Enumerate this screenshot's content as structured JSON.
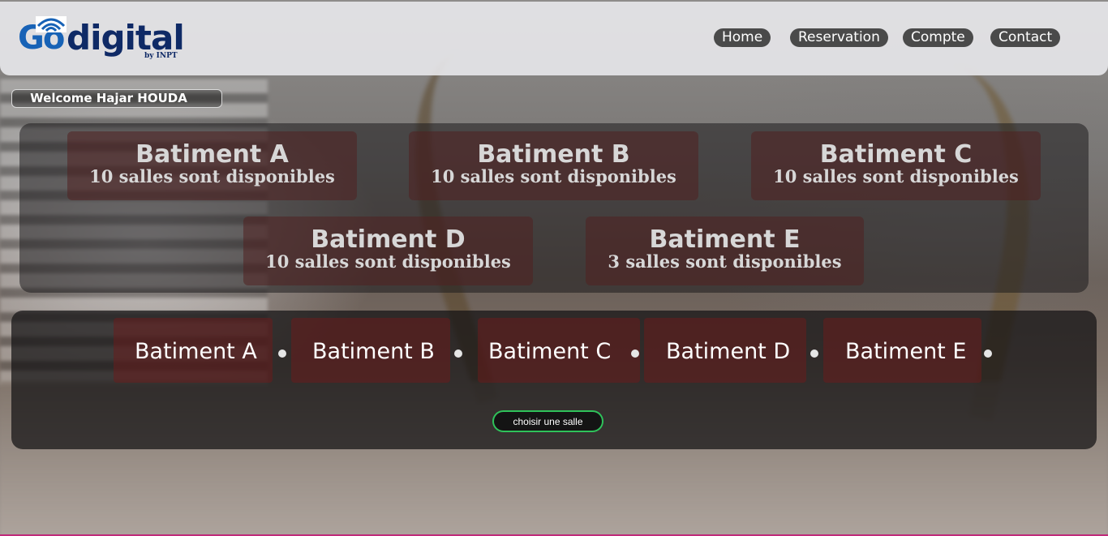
{
  "brand": {
    "logo_go": "Go",
    "logo_digital": "digital",
    "logo_by": "by INPT"
  },
  "nav": [
    {
      "label": "Home"
    },
    {
      "label": "Reservation"
    },
    {
      "label": "Compte"
    },
    {
      "label": "Contact"
    }
  ],
  "welcome": "Welcome Hajar HOUDA",
  "buildings": [
    {
      "name": "Batiment A",
      "availability": "10 salles sont disponibles"
    },
    {
      "name": "Batiment B",
      "availability": "10 salles sont disponibles"
    },
    {
      "name": "Batiment C",
      "availability": "10 salles sont disponibles"
    },
    {
      "name": "Batiment D",
      "availability": "10 salles sont disponibles"
    },
    {
      "name": "Batiment E",
      "availability": "3 salles sont disponibles"
    }
  ],
  "tabs": [
    {
      "label": "Batiment A"
    },
    {
      "label": "Batiment B"
    },
    {
      "label": "Batiment C"
    },
    {
      "label": "Batiment D"
    },
    {
      "label": "Batiment E"
    }
  ],
  "choose_button": "choisir une salle",
  "colors": {
    "accent_green": "#2fc25a",
    "brand_blue": "#1762b6",
    "brand_navy": "#0f2a66",
    "card_red": "#502020"
  }
}
